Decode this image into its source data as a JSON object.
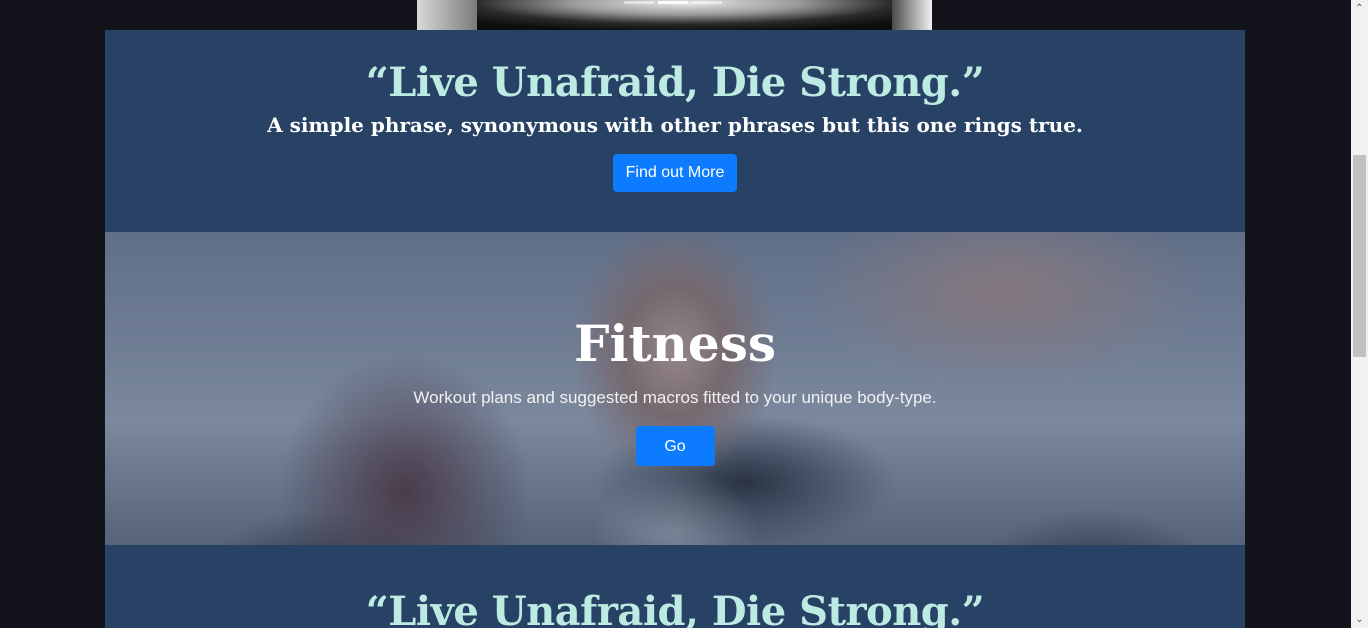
{
  "carousel": {
    "indicator_count": 3,
    "active_index": 1
  },
  "hero_quote": {
    "title": "“Live Unafraid, Die Strong.”",
    "subtitle": "A simple phrase, synonymous with other phrases but this one rings true.",
    "button_label": "Find out More"
  },
  "fitness": {
    "title": "Fitness",
    "text": "Workout plans and suggested macros fitted to your unique body-type.",
    "button_label": "Go"
  },
  "second_quote": {
    "title": "“Live Unafraid, Die Strong.”"
  },
  "scrollbar": {
    "up_glyph": "⌃",
    "down_glyph": "⌄"
  },
  "colors": {
    "page_background": "#13131b",
    "section_background": "#284266",
    "quote_title_color": "#bdebe3",
    "button_primary": "#0d7bfd"
  }
}
